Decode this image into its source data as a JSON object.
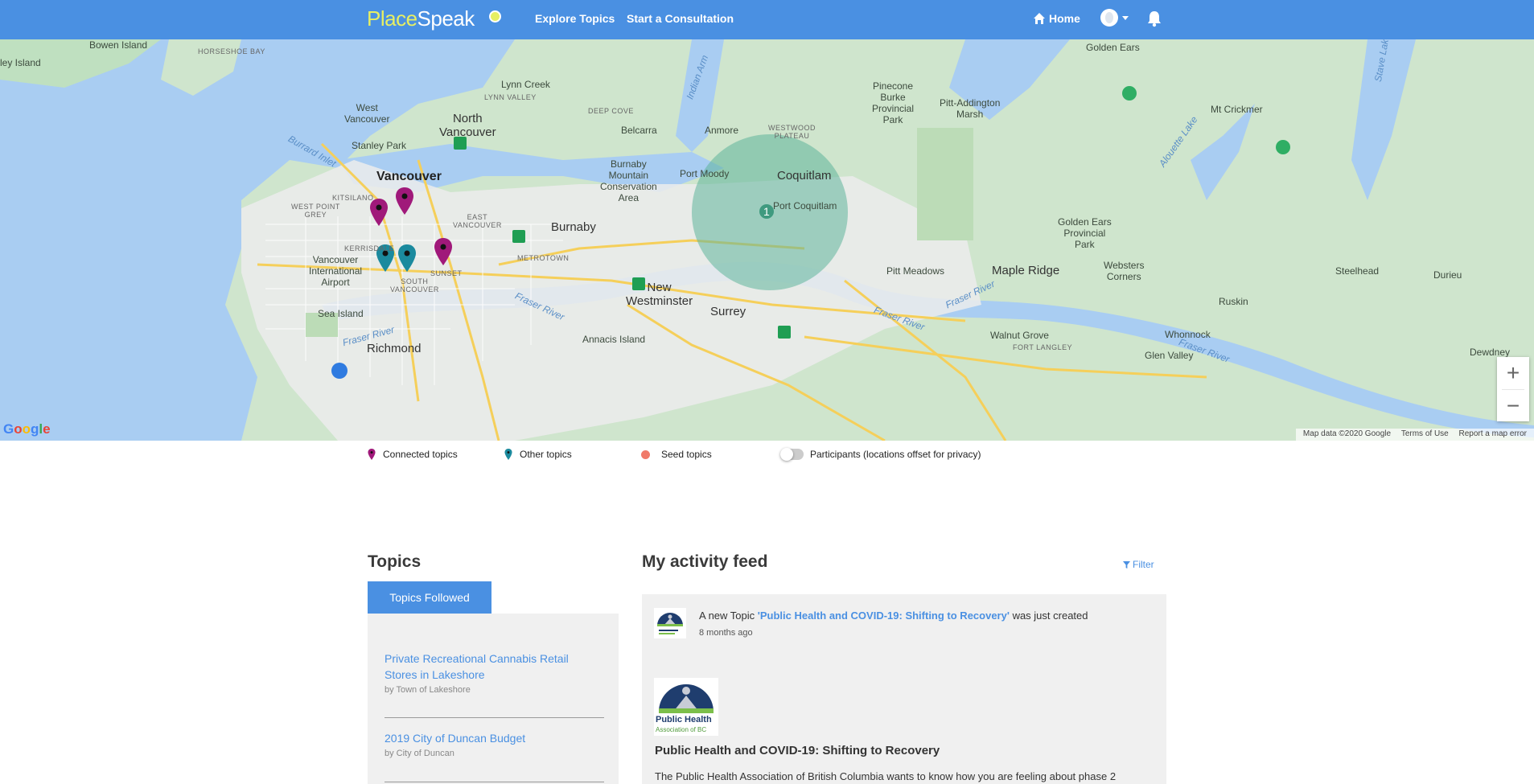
{
  "nav": {
    "logo_place": "Place",
    "logo_speak": "Speak",
    "explore": "Explore Topics",
    "consult": "Start a Consultation",
    "home": "Home"
  },
  "map": {
    "labels": {
      "bowen_island": "Bowen Island",
      "horseshoe_bay": "HORSESHOE BAY",
      "ley_island": "ley Island",
      "lynn_creek": "Lynn Creek",
      "lynn_valley": "LYNN VALLEY",
      "west_vancouver": "West\nVancouver",
      "north_vancouver": "North\nVancouver",
      "deep_cove": "DEEP COVE",
      "belcarra": "Belcarra",
      "anmore": "Anmore",
      "westwood_plateau": "WESTWOOD\nPLATEAU",
      "indian_arm": "Indian Arm",
      "pinecone_burke": "Pinecone\nBurke\nProvincial\nPark",
      "pitt_addington": "Pitt-Addington\nMarsh",
      "golden_ears_top": "Golden Ears",
      "mt_crickmer": "Mt Crickmer",
      "alouette_lake": "Alouette Lake",
      "stave_lake": "Stave Lake",
      "burrard_inlet": "Burrard Inlet",
      "stanley_park": "Stanley Park",
      "vancouver": "Vancouver",
      "burnaby_mountain": "Burnaby\nMountain\nConservation\nArea",
      "port_moody": "Port Moody",
      "coquitlam": "Coquitlam",
      "port_coquitlam": "Port Coquitlam",
      "kitsilano": "KITSILANO",
      "west_point_grey": "WEST POINT\nGREY",
      "east_vancouver": "EAST\nVANCOUVER",
      "burnaby": "Burnaby",
      "golden_ears_park": "Golden Ears\nProvincial\nPark",
      "kerrisdale": "KERRISDALE",
      "metrotown": "METROTOWN",
      "vancouver_airport": "Vancouver\nInternational\nAirport",
      "sunset": "SUNSET",
      "south_vancouver": "SOUTH\nVANCOUVER",
      "new_westminster": "New\nWestminster",
      "pitt_meadows": "Pitt Meadows",
      "maple_ridge": "Maple Ridge",
      "websters_corners": "Websters\nCorners",
      "steelhead": "Steelhead",
      "durieu": "Durieu",
      "sea_island": "Sea Island",
      "fraser_river_1": "Fraser River",
      "fraser_river_2": "Fraser River",
      "fraser_river_3": "Fraser River",
      "fraser_river_4": "Fraser River",
      "fraser_river_5": "Fraser River",
      "surrey": "Surrey",
      "ruskin": "Ruskin",
      "annacis_island": "Annacis Island",
      "richmond": "Richmond",
      "walnut_grove": "Walnut Grove",
      "fort_langley": "FORT LANGLEY",
      "whonnock": "Whonnock",
      "glen_valley": "Glen Valley",
      "dewdney": "Dewdney"
    },
    "cluster_count": "1",
    "google": "Google",
    "footer": {
      "map_data": "Map data ©2020 Google",
      "terms": "Terms of Use",
      "report": "Report a map error"
    },
    "zoom_in": "+",
    "zoom_out": "−"
  },
  "legend": {
    "connected": "Connected topics",
    "other": "Other topics",
    "seed": "Seed topics",
    "participants": "Participants (locations offset for privacy)",
    "connected_color": "#a0197a",
    "other_color": "#1b8a9e",
    "seed_color": "#f07a6a"
  },
  "topics": {
    "heading": "Topics",
    "tab_label": "Topics Followed",
    "items": [
      {
        "title": "Private Recreational Cannabis Retail Stores in Lakeshore",
        "by": "by Town of Lakeshore"
      },
      {
        "title": "2019 City of Duncan Budget",
        "by": "by City of Duncan"
      }
    ]
  },
  "feed": {
    "heading": "My activity feed",
    "filter": "Filter",
    "item": {
      "prefix": "A new Topic ",
      "topic_link": "'Public Health and COVID-19: Shifting to Recovery'",
      "suffix": " was just created",
      "time": "8 months ago",
      "card_title": "Public Health and COVID-19: Shifting to Recovery",
      "card_desc": "The Public Health Association of British Columbia wants to know how you are feeling about phase 2",
      "logo_line1": "Public Health",
      "logo_line2": "Association of BC"
    }
  }
}
